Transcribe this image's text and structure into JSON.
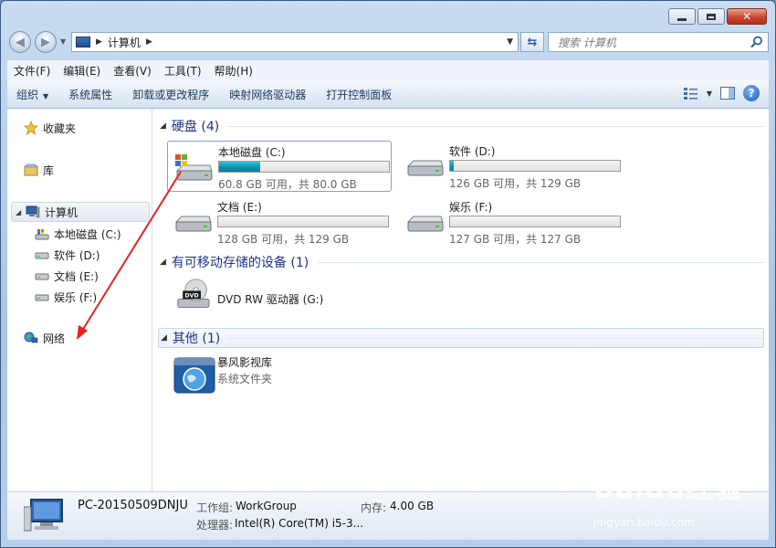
{
  "window": {
    "close_glyph": "✕"
  },
  "nav": {
    "back_glyph": "◀",
    "forward_glyph": "▶",
    "crumb": "计算机",
    "search_placeholder": "搜索 计算机"
  },
  "menu": [
    "文件(F)",
    "编辑(E)",
    "查看(V)",
    "工具(T)",
    "帮助(H)"
  ],
  "commands": [
    "组织",
    "系统属性",
    "卸载或更改程序",
    "映射网络驱动器",
    "打开控制面板"
  ],
  "help_glyph": "?",
  "nav_pane": {
    "favorites": "收藏夹",
    "libraries": "库",
    "computer": "计算机",
    "drives": [
      "本地磁盘 (C:)",
      "软件 (D:)",
      "文档 (E:)",
      "娱乐 (F:)"
    ],
    "network": "网络"
  },
  "groups": {
    "hard_disks": "硬盘 (4)",
    "removable": "有可移动存储的设备 (1)",
    "other": "其他 (1)"
  },
  "drives": [
    {
      "name": "本地磁盘 (C:)",
      "free": "60.8 GB 可用，共 80.0 GB",
      "used_fraction": 0.24
    },
    {
      "name": "软件 (D:)",
      "free": "126 GB 可用，共 129 GB",
      "used_fraction": 0.02
    },
    {
      "name": "文档 (E:)",
      "free": "128 GB 可用，共 129 GB",
      "used_fraction": 0.0
    },
    {
      "name": "娱乐 (F:)",
      "free": "127 GB 可用，共 127 GB",
      "used_fraction": 0.0
    }
  ],
  "dvd": {
    "name": "DVD RW 驱动器 (G:)",
    "label": "DVD"
  },
  "other_item": {
    "name": "暴风影视库",
    "type": "系统文件夹"
  },
  "details": {
    "pc_name": "PC-20150509DNJU",
    "workgroup_label": "工作组:",
    "workgroup": "WorkGroup",
    "memory_label": "内存:",
    "memory": "4.00 GB",
    "cpu_label": "处理器:",
    "cpu": "Intel(R) Core(TM) i5-3..."
  },
  "watermark": {
    "brand": "Baidu经验",
    "url": "jingyan.baidu.com"
  }
}
